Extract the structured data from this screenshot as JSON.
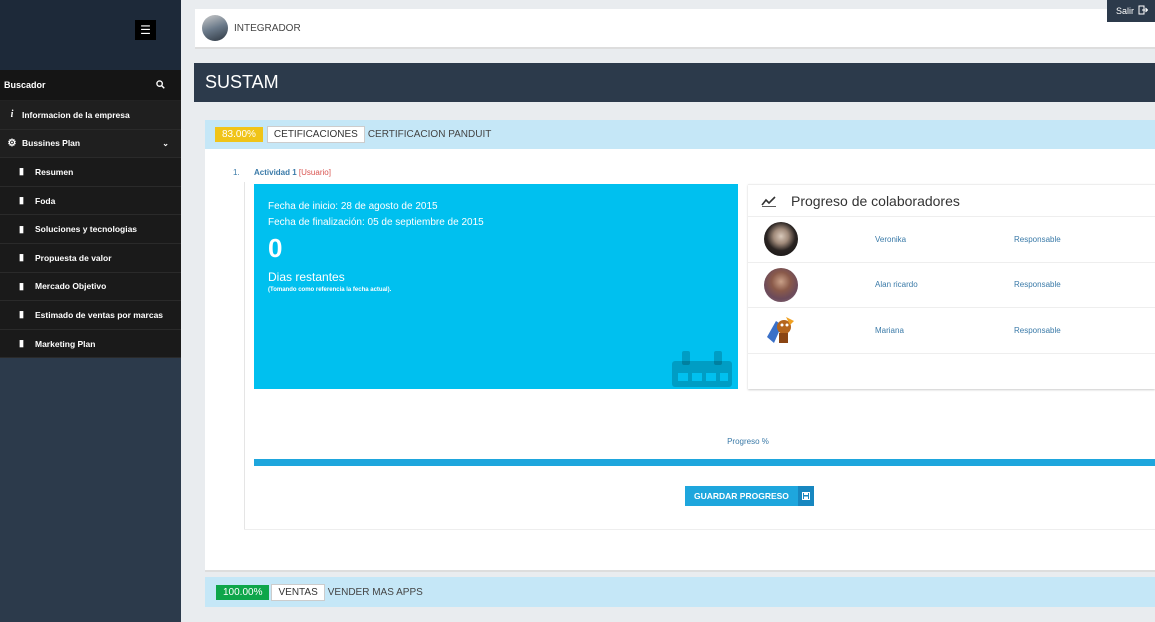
{
  "sidebar": {
    "menu_icon": "menu-icon",
    "search_label": "Buscador",
    "items": [
      {
        "label": "Informacion de la empresa",
        "icon": "info-icon"
      },
      {
        "label": "Bussines Plan",
        "icon": "gear-icon"
      }
    ],
    "subitems": [
      {
        "label": "Resumen"
      },
      {
        "label": "Foda"
      },
      {
        "label": "Soluciones y tecnologias"
      },
      {
        "label": "Propuesta de valor"
      },
      {
        "label": "Mercado Objetivo"
      },
      {
        "label": "Estimado de ventas por marcas"
      },
      {
        "label": "Marketing Plan"
      }
    ]
  },
  "header": {
    "role": "INTEGRADOR",
    "logout_label": "Salir"
  },
  "page_title": "SUSTAM",
  "certification": {
    "percent": "83.00%",
    "category": "CETIFICACIONES",
    "name": "CERTIFICACION PANDUIT"
  },
  "activity": {
    "number": "1.",
    "title": "Actividad 1",
    "owner": "[Usuario]",
    "start_date": "Fecha de inicio: 28 de agosto de 2015",
    "end_date": "Fecha de finalización: 05 de septiembre de 2015",
    "days_left": "0",
    "days_label": "Dias restantes",
    "days_note": "(Tomando como referencia la fecha actual)."
  },
  "collaborators": {
    "title": "Progreso de colaboradores",
    "rows": [
      {
        "name": "Veronika",
        "role": "Responsable"
      },
      {
        "name": "Alan ricardo",
        "role": "Responsable"
      },
      {
        "name": "Mariana",
        "role": "Responsable"
      }
    ]
  },
  "progress": {
    "label": "Progreso %",
    "value": 1.0,
    "save_label": "GUARDAR PROGRESO",
    "color": "#1ea6dd"
  },
  "sales": {
    "percent": "100.00%",
    "category": "VENTAS",
    "name": "VENDER MAS APPS"
  },
  "colors": {
    "sidebar": "#2c3a4b",
    "activity_box": "#00c0ef",
    "cert_bar": "#c5e7f7",
    "badge_warning": "#f0c419",
    "badge_success": "#0ea64a"
  }
}
